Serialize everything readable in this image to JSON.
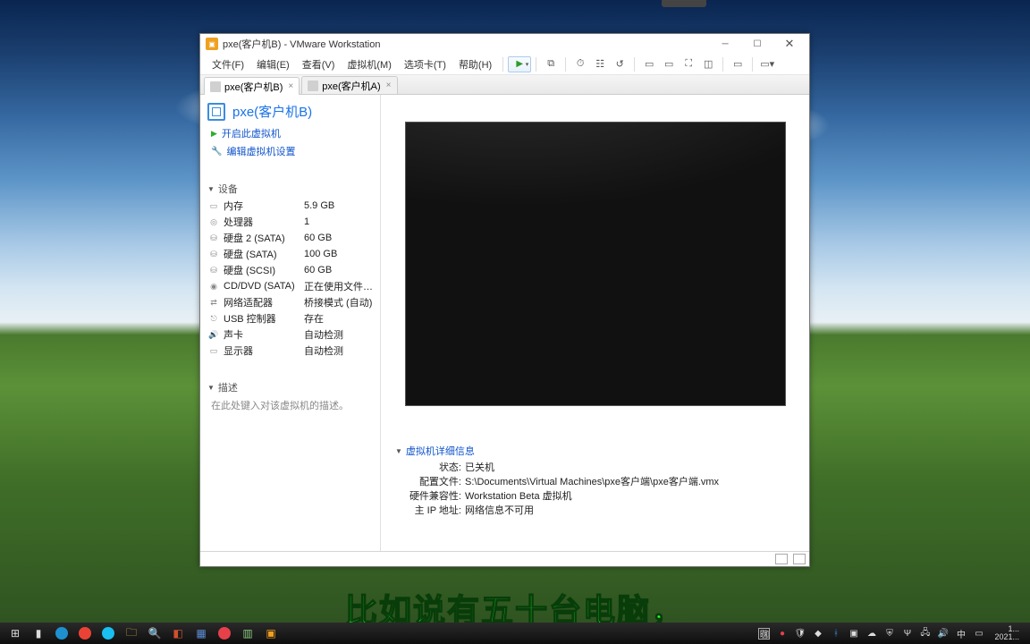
{
  "window": {
    "title": "pxe(客户机B) - VMware Workstation"
  },
  "menu": {
    "file": "文件(F)",
    "edit": "编辑(E)",
    "view": "查看(V)",
    "vm": "虚拟机(M)",
    "tabs": "选项卡(T)",
    "help": "帮助(H)"
  },
  "tabs": [
    {
      "label": "pxe(客户机B)",
      "active": true
    },
    {
      "label": "pxe(客户机A)",
      "active": false
    }
  ],
  "vm": {
    "name": "pxe(客户机B)",
    "actions": {
      "power_on": "开启此虚拟机",
      "edit_settings": "编辑虚拟机设置"
    },
    "devices_header": "设备",
    "devices": [
      {
        "icon": "▭",
        "label": "内存",
        "value": "5.9 GB"
      },
      {
        "icon": "◎",
        "label": "处理器",
        "value": "1"
      },
      {
        "icon": "⛁",
        "label": "硬盘 2 (SATA)",
        "value": "60 GB"
      },
      {
        "icon": "⛁",
        "label": "硬盘 (SATA)",
        "value": "100 GB"
      },
      {
        "icon": "⛁",
        "label": "硬盘 (SCSI)",
        "value": "60 GB"
      },
      {
        "icon": "◉",
        "label": "CD/DVD (SATA)",
        "value": "正在使用文件 S:..."
      },
      {
        "icon": "⇄",
        "label": "网络适配器",
        "value": "桥接模式 (自动)"
      },
      {
        "icon": "⎋",
        "label": "USB 控制器",
        "value": "存在"
      },
      {
        "icon": "🔊",
        "label": "声卡",
        "value": "自动检测"
      },
      {
        "icon": "▭",
        "label": "显示器",
        "value": "自动检测"
      }
    ],
    "desc_header": "描述",
    "desc_placeholder": "在此处键入对该虚拟机的描述。",
    "details_header": "虚拟机详细信息",
    "details": [
      {
        "k": "状态:",
        "v": "已关机"
      },
      {
        "k": "配置文件:",
        "v": "S:\\Documents\\Virtual Machines\\pxe客户端\\pxe客户端.vmx"
      },
      {
        "k": "硬件兼容性:",
        "v": "Workstation Beta 虚拟机"
      },
      {
        "k": "主 IP 地址:",
        "v": "网络信息不可用"
      }
    ]
  },
  "taskbar": {
    "clock_time": "1...",
    "clock_date": "2021...",
    "ime": "中"
  },
  "subtitle": "比如说有五十台电脑，"
}
